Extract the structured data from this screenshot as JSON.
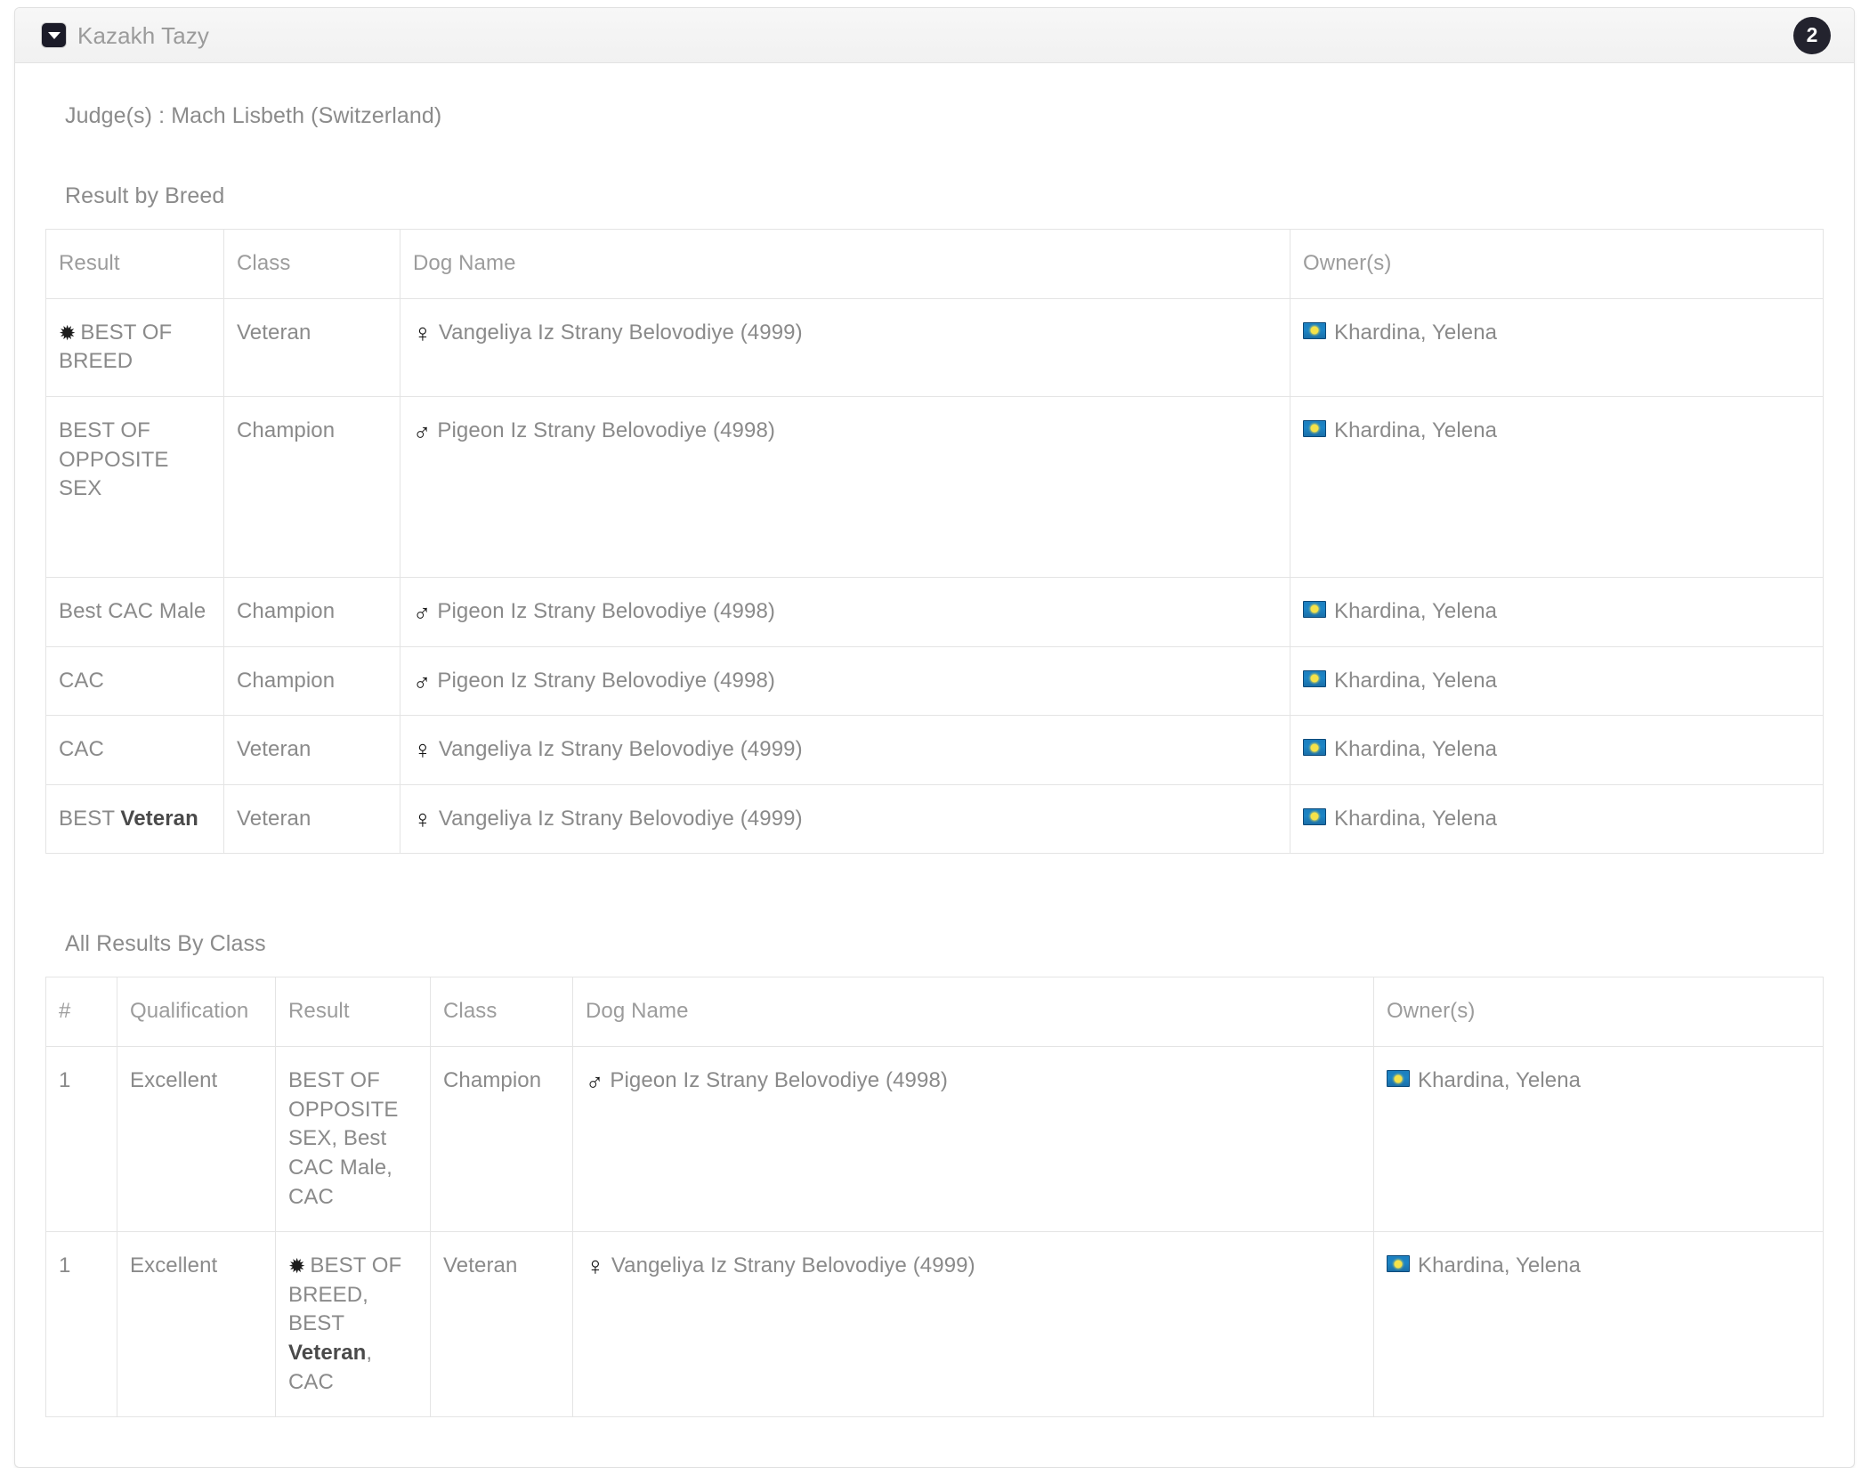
{
  "panel": {
    "title": "Kazakh Tazy",
    "collapse_icon": "caret-down-square-icon",
    "badge_count": "2"
  },
  "body": {
    "judges_line": "Judge(s) : Mach Lisbeth (Switzerland)",
    "section_breed_title": "Result by Breed",
    "section_class_title": "All Results By Class"
  },
  "result_by_breed": {
    "headers": {
      "result": "Result",
      "class": "Class",
      "dog_name": "Dog Name",
      "owners": "Owner(s)"
    },
    "rows": [
      {
        "result_main": "BEST OF BREED",
        "has_rosette": true,
        "class": "Veteran",
        "sex": "♀",
        "dog_name": "Vangeliya Iz Strany Belovodiye (4999)",
        "owner": "Khardina, Yelena",
        "owner_flag": "kazakhstan-flag-icon"
      },
      {
        "result_main": "BEST OF OPPOSITE SEX",
        "has_rosette": false,
        "class": "Champion",
        "sex": "♂",
        "dog_name": "Pigeon Iz Strany Belovodiye (4998)",
        "owner": "Khardina, Yelena",
        "owner_flag": "kazakhstan-flag-icon"
      },
      {
        "result_main": "Best CAC Male",
        "has_rosette": false,
        "class": "Champion",
        "sex": "♂",
        "dog_name": "Pigeon Iz Strany Belovodiye (4998)",
        "owner": "Khardina, Yelena",
        "owner_flag": "kazakhstan-flag-icon"
      },
      {
        "result_main": "CAC",
        "has_rosette": false,
        "class": "Champion",
        "sex": "♂",
        "dog_name": "Pigeon Iz Strany Belovodiye (4998)",
        "owner": "Khardina, Yelena",
        "owner_flag": "kazakhstan-flag-icon"
      },
      {
        "result_main": "CAC",
        "has_rosette": false,
        "class": "Veteran",
        "sex": "♀",
        "dog_name": "Vangeliya Iz Strany Belovodiye (4999)",
        "owner": "Khardina, Yelena",
        "owner_flag": "kazakhstan-flag-icon"
      },
      {
        "result_prefix": "BEST ",
        "result_bold": "Veteran",
        "has_rosette": false,
        "class": "Veteran",
        "sex": "♀",
        "dog_name": "Vangeliya Iz Strany Belovodiye (4999)",
        "owner": "Khardina, Yelena",
        "owner_flag": "kazakhstan-flag-icon"
      }
    ]
  },
  "all_results_by_class": {
    "headers": {
      "num": "#",
      "qualification": "Qualification",
      "result": "Result",
      "class": "Class",
      "dog_name": "Dog Name",
      "owners": "Owner(s)"
    },
    "rows": [
      {
        "num": "1",
        "qualification": "Excellent",
        "has_rosette": false,
        "result": "BEST OF OPPOSITE SEX, Best CAC Male, CAC",
        "class": "Champion",
        "sex": "♂",
        "dog_name": "Pigeon Iz Strany Belovodiye (4998)",
        "owner": "Khardina, Yelena",
        "owner_flag": "kazakhstan-flag-icon"
      },
      {
        "num": "1",
        "qualification": "Excellent",
        "has_rosette": true,
        "result_part1": "BEST OF BREED, BEST ",
        "result_bold": "Veteran",
        "result_part2": ", CAC",
        "class": "Veteran",
        "sex": "♀",
        "dog_name": "Vangeliya Iz Strany Belovodiye (4999)",
        "owner": "Khardina, Yelena",
        "owner_flag": "kazakhstan-flag-icon"
      }
    ]
  },
  "icons": {
    "rosette": "✹"
  }
}
